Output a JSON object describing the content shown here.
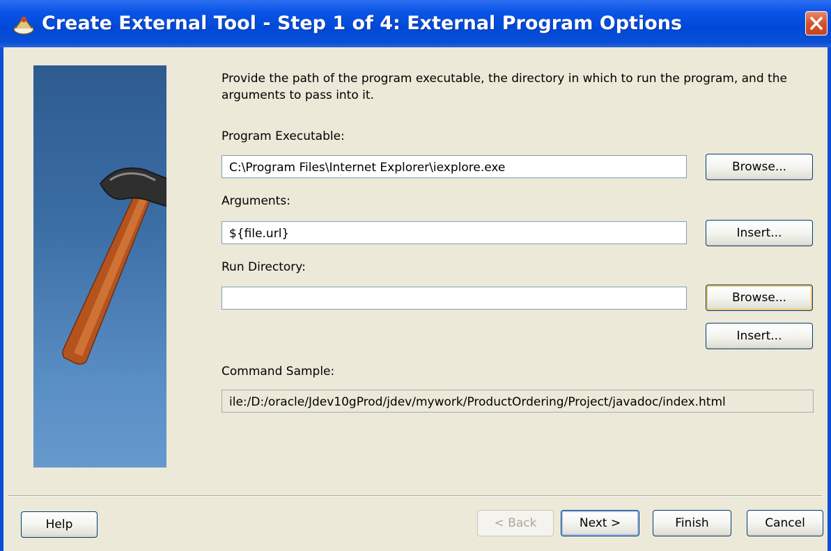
{
  "window": {
    "title": "Create External Tool - Step 1 of 4: External Program Options"
  },
  "description": "Provide the path of the program executable, the directory in which to run the program, and the arguments to pass into it.",
  "program_executable": {
    "label": "Program Executable:",
    "value": "C:\\Program Files\\Internet Explorer\\iexplore.exe",
    "browse": "Browse..."
  },
  "arguments": {
    "label": "Arguments:",
    "value": "${file.url}",
    "insert": "Insert..."
  },
  "run_directory": {
    "label": "Run Directory:",
    "value": "",
    "browse": "Browse...",
    "insert": "Insert..."
  },
  "command_sample": {
    "label": "Command Sample:",
    "value": "ile:/D:/oracle/Jdev10gProd/jdev/mywork/ProductOrdering/Project/javadoc/index.html"
  },
  "footer": {
    "help": "Help",
    "back": "< Back",
    "next": "Next >",
    "finish": "Finish",
    "cancel": "Cancel"
  },
  "icons": {
    "title": "wizard-icon",
    "close": "close-icon",
    "side": "hammer-illustration"
  },
  "colors": {
    "titlebar": "#0a55e6",
    "close": "#d6522c",
    "dialog": "#ece9d8",
    "side_panel": "#3b6ea5"
  }
}
